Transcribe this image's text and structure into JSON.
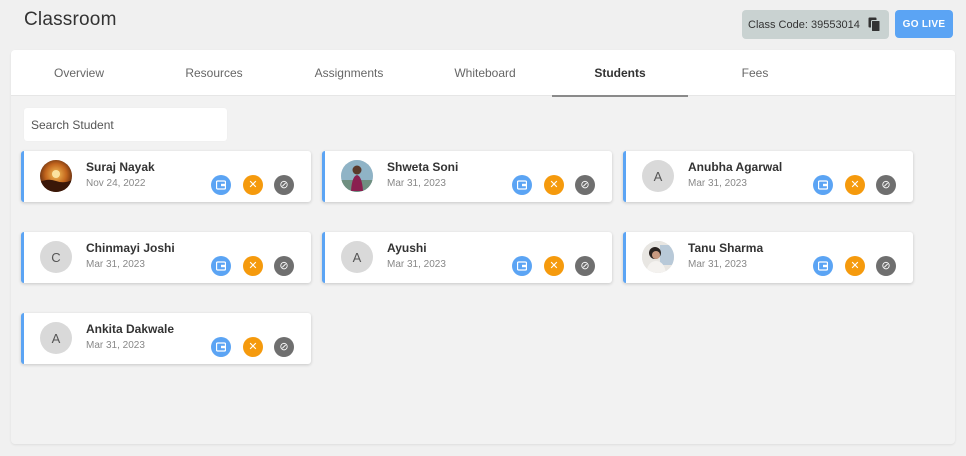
{
  "page": {
    "title": "Classroom"
  },
  "header": {
    "class_code": "Class Code: 39553014",
    "go_live_label": "GO LIVE"
  },
  "tabs": [
    {
      "label": "Overview",
      "active": false
    },
    {
      "label": "Resources",
      "active": false
    },
    {
      "label": "Assignments",
      "active": false
    },
    {
      "label": "Whiteboard",
      "active": false
    },
    {
      "label": "Students",
      "active": true
    },
    {
      "label": "Fees",
      "active": false
    }
  ],
  "search": {
    "placeholder": "Search Student"
  },
  "students": [
    {
      "name": "Suraj Nayak",
      "date": "Nov 24, 2022",
      "avatar": "",
      "avatar_type": "photo-sunset"
    },
    {
      "name": "Shweta Soni",
      "date": "Mar 31, 2023",
      "avatar": "",
      "avatar_type": "photo-person"
    },
    {
      "name": "Anubha Agarwal",
      "date": "Mar 31, 2023",
      "avatar": "A",
      "avatar_type": "initial"
    },
    {
      "name": "Chinmayi Joshi",
      "date": "Mar 31, 2023",
      "avatar": "C",
      "avatar_type": "initial"
    },
    {
      "name": "Ayushi",
      "date": "Mar 31, 2023",
      "avatar": "A",
      "avatar_type": "initial"
    },
    {
      "name": "Tanu Sharma",
      "date": "Mar 31, 2023",
      "avatar": "",
      "avatar_type": "photo-person"
    },
    {
      "name": "Ankita Dakwale",
      "date": "Mar 31, 2023",
      "avatar": "A",
      "avatar_type": "initial"
    }
  ],
  "actions": {
    "fee_icon": "wallet-icon",
    "remove_icon": "close-icon",
    "block_icon": "block-icon",
    "remove_glyph": "✕",
    "block_glyph": "⊘"
  },
  "colors": {
    "accent": "#5ba4f4",
    "remove": "#f59a0d",
    "block": "#6f6f6f",
    "class_code_bg": "#c9d2d1"
  }
}
